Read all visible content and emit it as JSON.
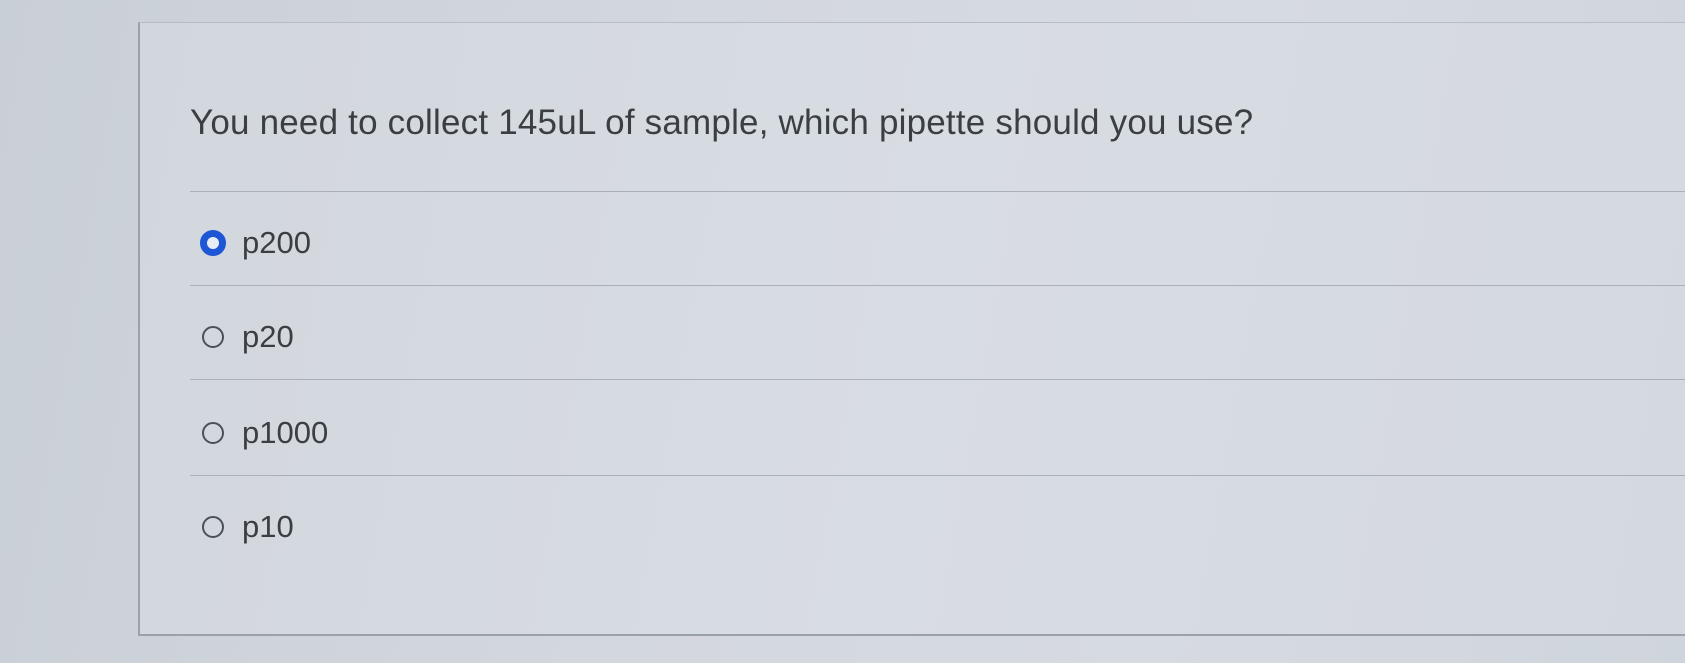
{
  "question": {
    "text": "You need to collect 145uL of sample, which pipette should you use?"
  },
  "options": [
    {
      "label": "p200",
      "selected": true
    },
    {
      "label": "p20",
      "selected": false
    },
    {
      "label": "p1000",
      "selected": false
    },
    {
      "label": "p10",
      "selected": false
    }
  ],
  "colors": {
    "selected_radio": "#1e56d6",
    "text": "#3b3f44",
    "background": "#d3d8de"
  }
}
